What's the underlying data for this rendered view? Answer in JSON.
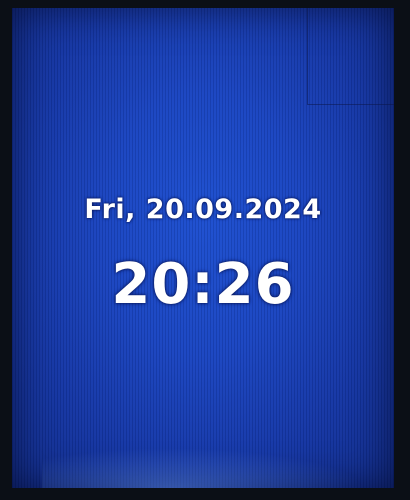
{
  "clock": {
    "date": "Fri, 20.09.2024",
    "time": "20:26"
  },
  "colors": {
    "screen_background": "#1a45c2",
    "text": "#ffffff"
  }
}
